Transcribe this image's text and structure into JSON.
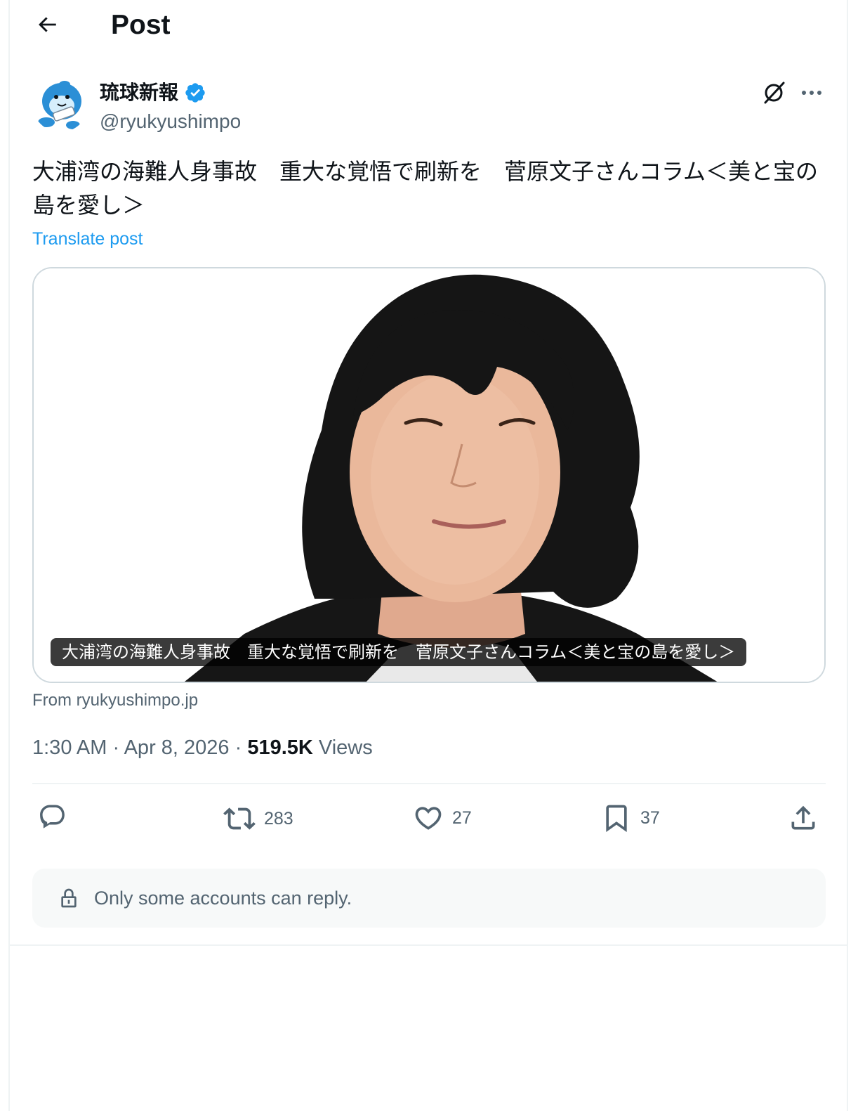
{
  "header": {
    "title": "Post",
    "back_icon": "arrow-left-icon"
  },
  "author": {
    "display_name": "琉球新報",
    "handle": "@ryukyushimpo",
    "verified": true,
    "verified_color": "#1d9bf0",
    "avatar_icon": "mascot-avatar"
  },
  "post": {
    "text": "大浦湾の海難人身事故　重大な覚悟で刷新を　菅原文子さんコラム＜美と宝の島を愛し＞",
    "translate_label": "Translate post",
    "card": {
      "caption": "大浦湾の海難人身事故　重大な覚悟で刷新を　菅原文子さんコラム＜美と宝の島を愛し＞",
      "source": "From ryukyushimpo.jp"
    },
    "time": "1:30 AM",
    "date": "Apr 8, 2026",
    "views_count": "519.5K",
    "views_label": "Views"
  },
  "actions": {
    "reply_count": "",
    "repost_count": "283",
    "like_count": "27",
    "bookmark_count": "37"
  },
  "reply_restriction": {
    "text": "Only some accounts can reply."
  },
  "colors": {
    "accent": "#1d9bf0",
    "muted": "#536471",
    "text": "#0f1419",
    "border": "#cfd9de"
  }
}
